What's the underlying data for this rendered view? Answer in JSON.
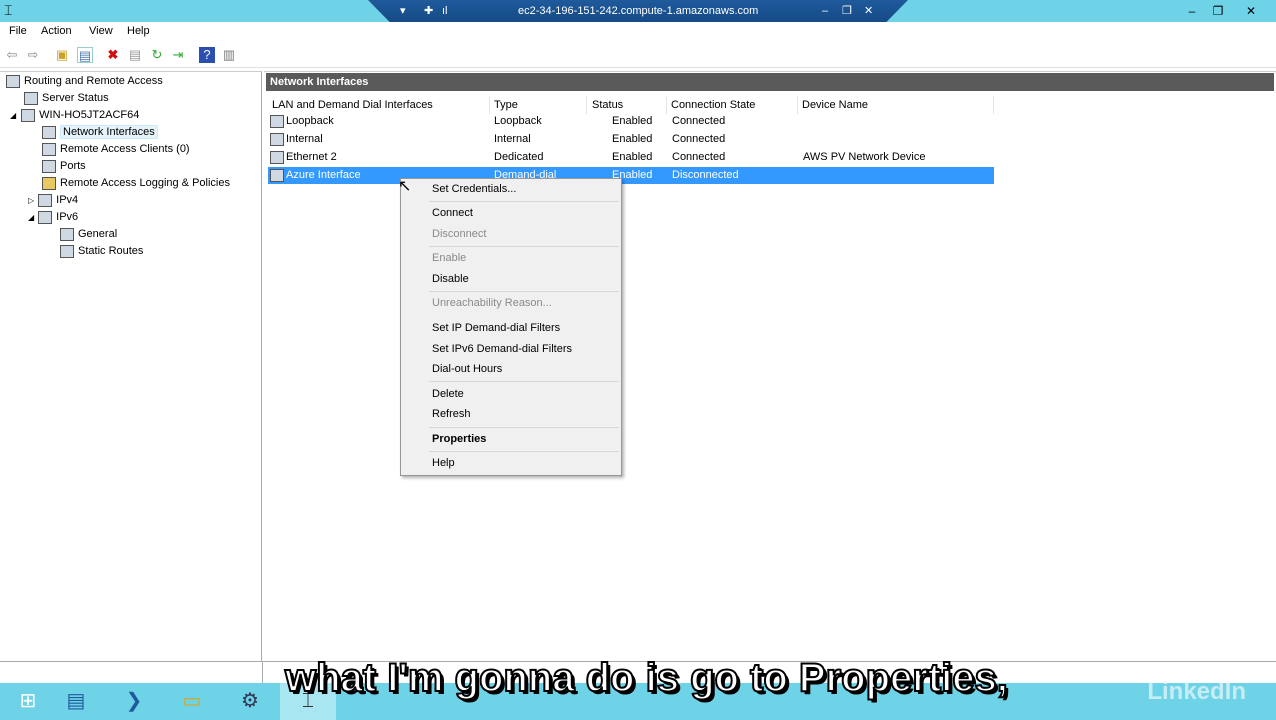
{
  "window": {
    "remote_host": "ec2-34-196-151-242.compute-1.amazonaws.com"
  },
  "menu": [
    "File",
    "Action",
    "View",
    "Help"
  ],
  "tree": {
    "root": "Routing and Remote Access",
    "items": [
      {
        "label": "Server Status",
        "level": 1
      },
      {
        "label": "WIN-HO5JT2ACF64",
        "level": 1,
        "expanded": true
      },
      {
        "label": "Network Interfaces",
        "level": 2,
        "selected": true
      },
      {
        "label": "Remote Access Clients (0)",
        "level": 2
      },
      {
        "label": "Ports",
        "level": 2
      },
      {
        "label": "Remote Access Logging & Policies",
        "level": 2
      },
      {
        "label": "IPv4",
        "level": 2,
        "collapsed": true
      },
      {
        "label": "IPv6",
        "level": 2,
        "expanded": true
      },
      {
        "label": "General",
        "level": 3
      },
      {
        "label": "Static Routes",
        "level": 3
      }
    ]
  },
  "panel": {
    "title": "Network Interfaces",
    "columns": [
      "LAN and Demand Dial Interfaces",
      "Type",
      "Status",
      "Connection State",
      "Device Name"
    ],
    "rows": [
      [
        "Loopback",
        "Loopback",
        "Enabled",
        "Connected",
        ""
      ],
      [
        "Internal",
        "Internal",
        "Enabled",
        "Connected",
        ""
      ],
      [
        "Ethernet 2",
        "Dedicated",
        "Enabled",
        "Connected",
        "AWS PV Network Device"
      ],
      [
        "Azure Interface",
        "Demand-dial",
        "Enabled",
        "Disconnected",
        ""
      ]
    ]
  },
  "context_menu": [
    "Set Credentials...",
    "Connect",
    "Disconnect",
    "Enable",
    "Disable",
    "Unreachability Reason...",
    "Set IP Demand-dial Filters",
    "Set IPv6 Demand-dial Filters",
    "Dial-out Hours",
    "Delete",
    "Refresh",
    "Properties",
    "Help"
  ],
  "caption": "what I'm gonna do is go to Properties,",
  "watermark": "LinkedIn"
}
